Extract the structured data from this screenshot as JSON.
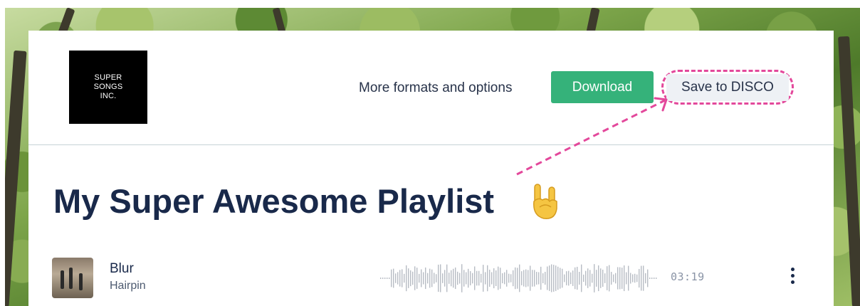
{
  "logo": {
    "text": "SUPER\nSONGS\nINC."
  },
  "header": {
    "more_link": "More formats and options",
    "download_label": "Download",
    "save_disco_label": "Save to DISCO"
  },
  "playlist": {
    "title": "My Super Awesome Playlist",
    "title_emoji": "sign-of-the-horns-emoji"
  },
  "tracks": [
    {
      "title": "Blur",
      "artist": "Hairpin",
      "duration": "03:19"
    }
  ],
  "colors": {
    "accent_green": "#35b27a",
    "highlight_pink": "#e3489b",
    "title_navy": "#19294a"
  }
}
